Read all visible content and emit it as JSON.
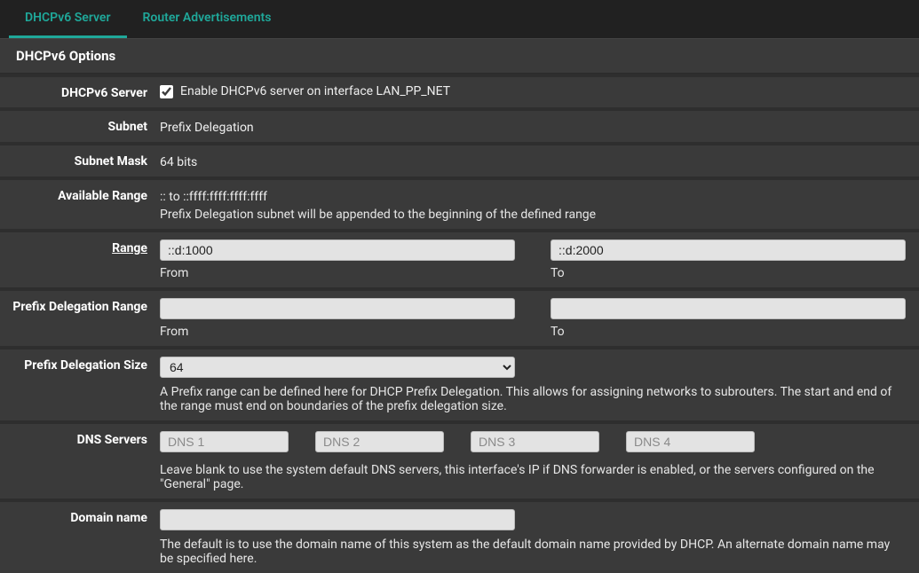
{
  "tabs": {
    "dhcp": "DHCPv6 Server",
    "ra": "Router Advertisements"
  },
  "section_title": "DHCPv6 Options",
  "server": {
    "label": "DHCPv6 Server",
    "checkbox_label": "Enable DHCPv6 server on interface LAN_PP_NET"
  },
  "subnet": {
    "label": "Subnet",
    "value": "Prefix Delegation"
  },
  "mask": {
    "label": "Subnet Mask",
    "value": "64 bits"
  },
  "avail": {
    "label": "Available Range",
    "value": ":: to ::ffff:ffff:ffff:ffff",
    "help": "Prefix Delegation subnet will be appended to the beginning of the defined range"
  },
  "range": {
    "label": "Range",
    "from_value": "::d:1000",
    "to_value": "::d:2000",
    "from_caption": "From",
    "to_caption": "To"
  },
  "pdrange": {
    "label": "Prefix Delegation Range",
    "from_value": "",
    "to_value": "",
    "from_caption": "From",
    "to_caption": "To"
  },
  "pdsize": {
    "label": "Prefix Delegation Size",
    "value": "64",
    "help": "A Prefix range can be defined here for DHCP Prefix Delegation. This allows for assigning networks to subrouters. The start and end of the range must end on boundaries of the prefix delegation size."
  },
  "dns": {
    "label": "DNS Servers",
    "ph1": "DNS 1",
    "ph2": "DNS 2",
    "ph3": "DNS 3",
    "ph4": "DNS 4",
    "v1": "",
    "v2": "",
    "v3": "",
    "v4": "",
    "help": "Leave blank to use the system default DNS servers, this interface's IP if DNS forwarder is enabled, or the servers configured on the \"General\" page."
  },
  "domain": {
    "label": "Domain name",
    "value": "",
    "help": "The default is to use the domain name of this system as the default domain name provided by DHCP. An alternate domain name may be specified here."
  }
}
